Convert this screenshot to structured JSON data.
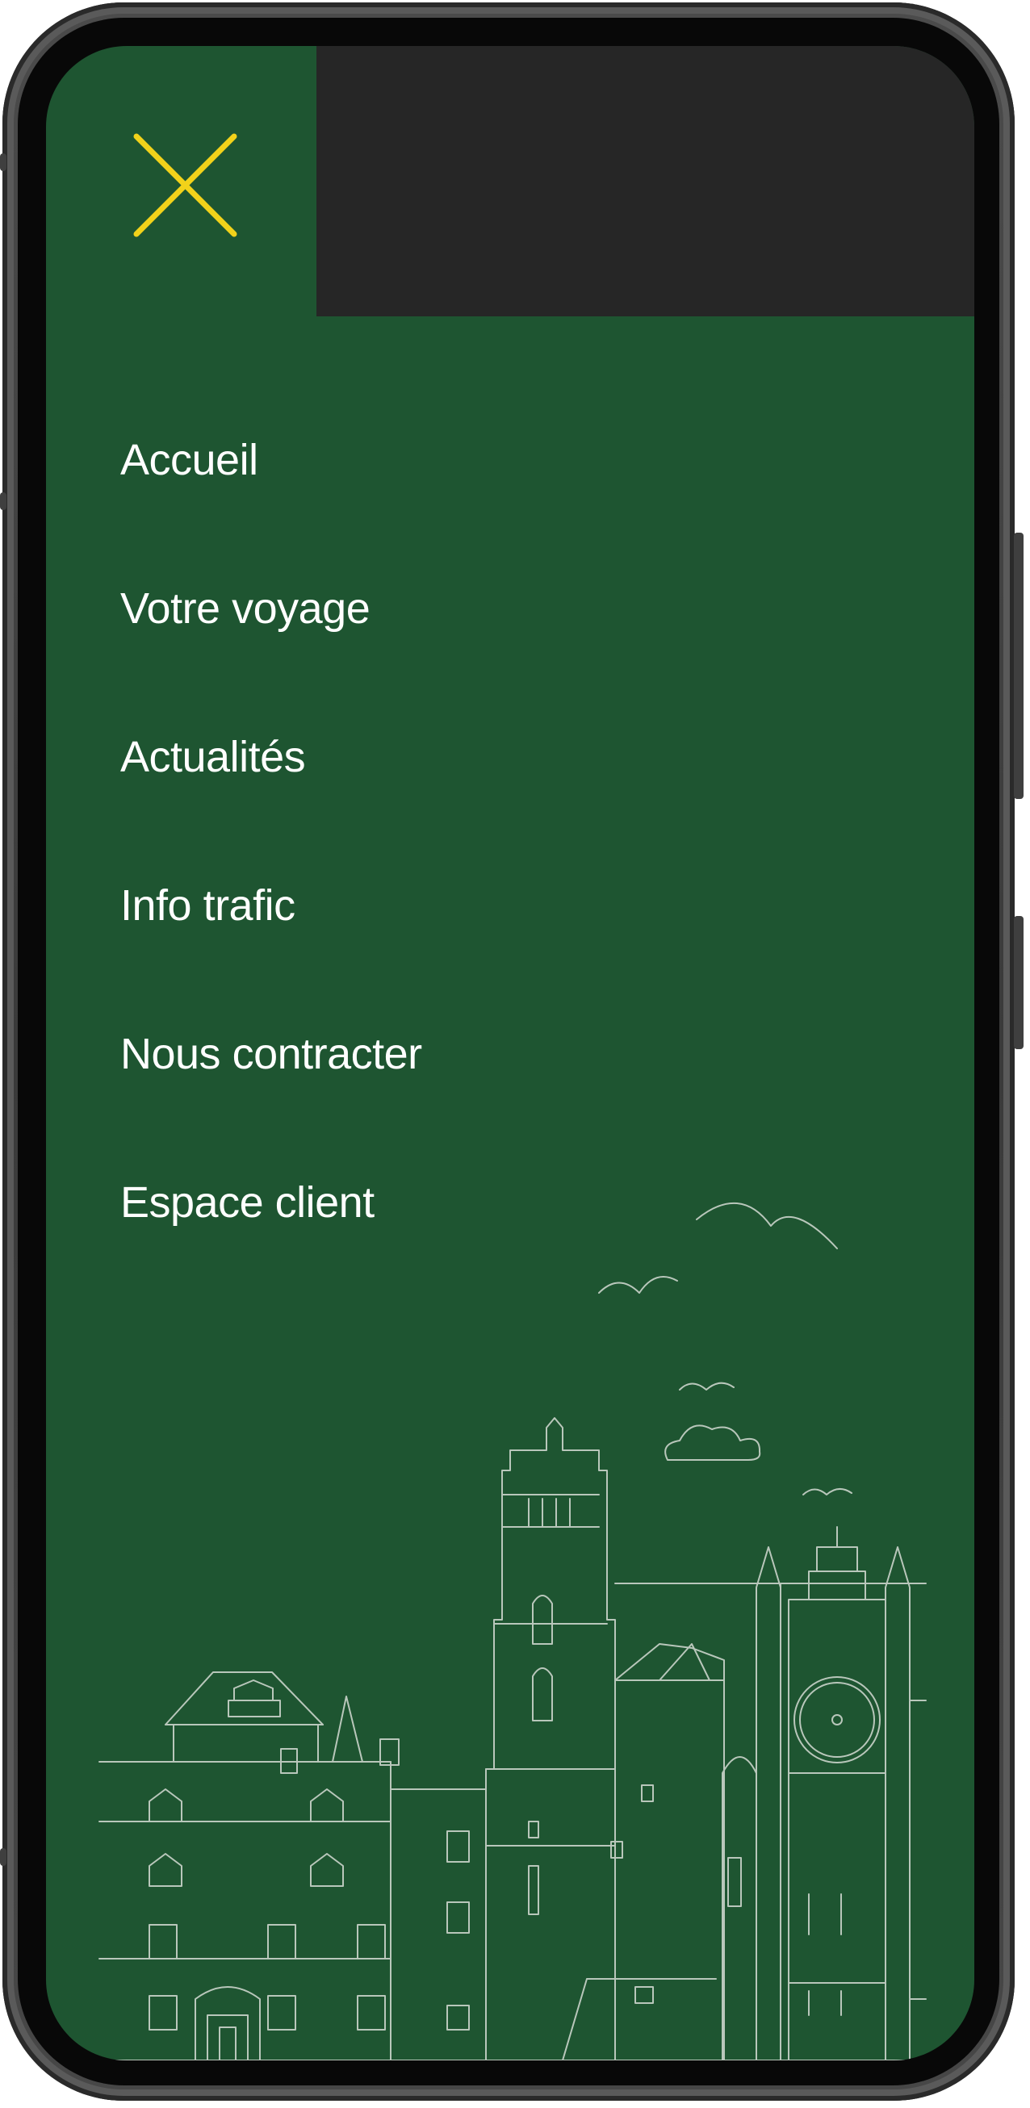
{
  "menu": {
    "close_icon": "close-x-icon",
    "items": [
      {
        "label": "Accueil"
      },
      {
        "label": "Votre voyage"
      },
      {
        "label": "Actualités"
      },
      {
        "label": "Info trafic"
      },
      {
        "label": "Nous contracter"
      },
      {
        "label": "Espace client"
      }
    ]
  },
  "colors": {
    "background_green": "#1e5531",
    "top_dark": "#262626",
    "close_icon": "#f2d21a",
    "menu_text": "#ffffff",
    "illustration_line": "#b9c7bb"
  },
  "illustration": {
    "name": "city-skyline-illustration"
  }
}
